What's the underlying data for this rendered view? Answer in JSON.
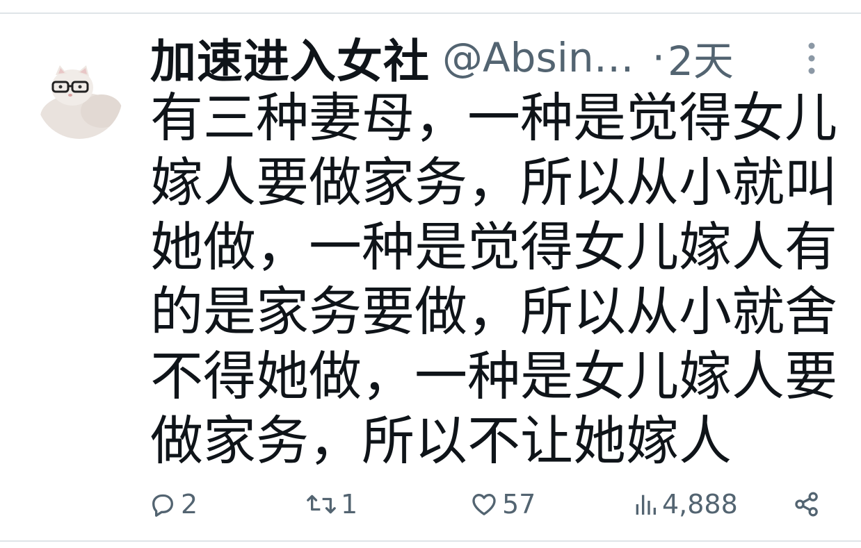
{
  "tweet": {
    "display_name": "加速进入女社",
    "handle": "@Absin…",
    "separator": "·",
    "time": "2天",
    "text": "有三种妻母，一种是觉得女儿嫁人要做家务，所以从小就叫她做，一种是觉得女儿嫁人有的是家务要做，所以从小就舍不得她做，一种是女儿嫁人要做家务，所以不让她嫁人"
  },
  "actions": {
    "reply": {
      "icon": "reply-icon",
      "count": "2"
    },
    "retweet": {
      "icon": "retweet-icon",
      "count": "1"
    },
    "like": {
      "icon": "heart-icon",
      "count": "57"
    },
    "views": {
      "icon": "views-icon",
      "count": "4,888"
    },
    "share": {
      "icon": "share-icon"
    }
  },
  "colors": {
    "text": "#0f1419",
    "secondary": "#536471",
    "divider": "#dfe4e7",
    "background": "#ffffff"
  }
}
